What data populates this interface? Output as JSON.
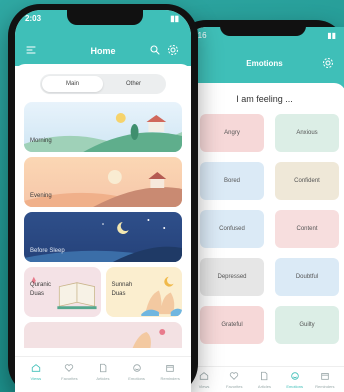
{
  "emotions_screen": {
    "status_time": "9:16",
    "title": "Emotions",
    "prompt": "I am feeling ...",
    "emotions": [
      {
        "label": "Angry",
        "color": "#f6d8d8"
      },
      {
        "label": "Anxious",
        "color": "#dceee6"
      },
      {
        "label": "Bored",
        "color": "#dbeaf6"
      },
      {
        "label": "Confident",
        "color": "#efe8d8"
      },
      {
        "label": "Confused",
        "color": "#dbeaf6"
      },
      {
        "label": "Content",
        "color": "#f7dede"
      },
      {
        "label": "Depressed",
        "color": "#e6e6e6"
      },
      {
        "label": "Doubtful",
        "color": "#dbeaf6"
      },
      {
        "label": "Grateful",
        "color": "#f6d8d8"
      },
      {
        "label": "Guilty",
        "color": "#dceee6"
      }
    ],
    "tabs": [
      {
        "label": "Views",
        "icon": "home-icon",
        "active": false
      },
      {
        "label": "Favorites",
        "icon": "heart-icon",
        "active": false
      },
      {
        "label": "Articles",
        "icon": "document-icon",
        "active": false
      },
      {
        "label": "Emotions",
        "icon": "smiley-icon",
        "active": true
      },
      {
        "label": "Reminders",
        "icon": "calendar-icon",
        "active": false
      }
    ]
  },
  "home_screen": {
    "status_time": "2:03",
    "title": "Home",
    "segments": {
      "main": "Main",
      "other": "Other"
    },
    "cards": {
      "morning": "Morning",
      "evening": "Evening",
      "before_sleep": "Before Sleep",
      "quranic_duas": "Quranic\nDuas",
      "sunnah_duas": "Sunnah\nDuas"
    },
    "tabs": [
      {
        "label": "Views",
        "icon": "home-icon",
        "active": true
      },
      {
        "label": "Favorites",
        "icon": "heart-icon",
        "active": false
      },
      {
        "label": "Articles",
        "icon": "document-icon",
        "active": false
      },
      {
        "label": "Emotions",
        "icon": "smiley-icon",
        "active": false
      },
      {
        "label": "Reminders",
        "icon": "calendar-icon",
        "active": false
      }
    ]
  },
  "colors": {
    "brand": "#3fbfb8",
    "background": "#1f948f"
  }
}
